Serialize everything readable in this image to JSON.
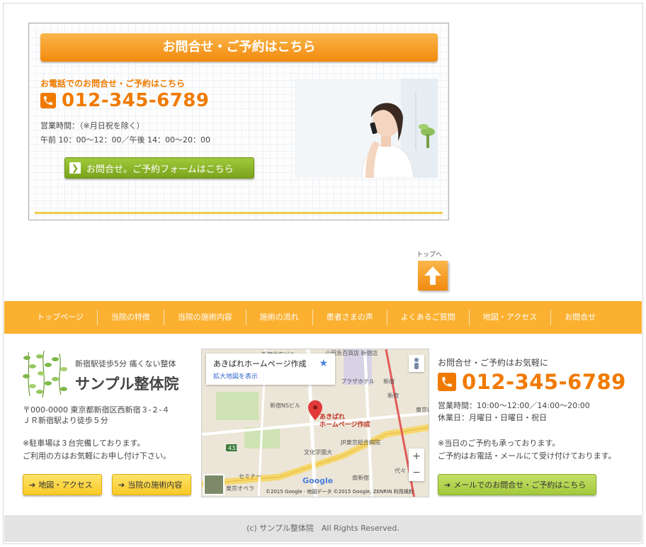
{
  "contact": {
    "header": "お問合せ・ご予約はこちら",
    "tel_label": "お電話でのお問合せ・ご予約はこちら",
    "tel_number": "012-345-6789",
    "hours_line1": "営業時間：（※月日祝を除く）",
    "hours_line2": "午前 10：00～12：00／午後 14：00～20：00",
    "form_button": "お問合せ。ご予約フォームはこちら"
  },
  "back_to_top": {
    "label": "トップへ"
  },
  "nav": {
    "items": [
      "トップページ",
      "当院の特徴",
      "当院の施術内容",
      "施術の流れ",
      "患者さまの声",
      "よくあるご質問",
      "地図・アクセス",
      "お問合せ"
    ]
  },
  "clinic": {
    "tagline": "新宿駅徒歩5分 痛くない整体",
    "name": "サンプル整体院",
    "address_line1": "〒000-0000 東京都新宿区西新宿３-２-４",
    "address_line2": "ＪＲ新宿駅より徒歩５分",
    "parking_line1": "※駐車場は３台完備しております。",
    "parking_line2": "ご利用の方はお気軽にお申し付け下さい。",
    "btn_access": "地図・アクセス",
    "btn_treatment": "当院の施術内容"
  },
  "map": {
    "card_title": "あきばれホームページ作成",
    "card_link": "拡大地図を表示",
    "pin_label_line1": "あきばれ",
    "pin_label_line2": "ホームページ作成",
    "labels": {
      "l1": "新宿住友ビル",
      "l2": "小田急百貨店 新宿店",
      "l3": "プラザホテル",
      "l4": "新宿",
      "l5": "新宿NSビル",
      "l6": "JR東京総合病院",
      "l7": "文化学園大",
      "l8": "南新宿",
      "l9": "東京オペラ",
      "l10": "セミナー",
      "l11": "東京都庁",
      "l12": "新宿",
      "l13": "代々",
      "l14": "431"
    },
    "google": "Google",
    "footer": "©2015 Google · 地図データ ©2015 Google, ZENRIN  利用規約"
  },
  "right": {
    "label": "お問合せ・ご予約はお気軽に",
    "tel_number": "012-345-6789",
    "hours_line1": "営業時間：10:00～12:00／14:00～20:00",
    "hours_line2": "休業日：月曜日・日曜日・祝日",
    "note_line1": "※当日のご予約も承っております。",
    "note_line2": "ご予約はお電話・メールにて受け付けております。",
    "mail_button": "メールでのお問合せ・ご予約はこちら"
  },
  "footer": {
    "copyright": "(c) サンプル整体院　All Rights Reserved."
  }
}
